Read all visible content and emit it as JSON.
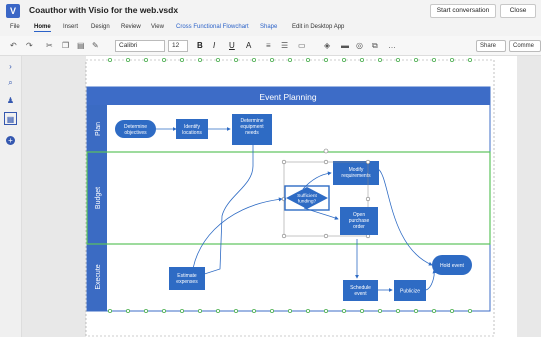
{
  "app": {
    "title": "Coauthor with Visio for the web.vsdx",
    "start_conversation": "Start conversation",
    "close": "Close"
  },
  "tabs": [
    "File",
    "Home",
    "Insert",
    "Design",
    "Review",
    "View",
    "Cross Functional Flowchart",
    "Shape",
    "Edit in Desktop App"
  ],
  "ribbon": {
    "font_name": "Calibri",
    "font_size": "12",
    "share": "Share",
    "comments": "Comme"
  },
  "diagram": {
    "title": "Event Planning",
    "lanes": [
      "Plan",
      "Budget",
      "Execute"
    ],
    "shapes": {
      "determine_objectives": "Determine objectives",
      "identify_locations": "Identify locations",
      "determine_equipment": "Determine equipment needs",
      "modify_requirements": "Modify requirements",
      "sufficient_funding": "Sufficient funding?",
      "open_purchase_order": "Open purchase order",
      "estimate_expenses": "Estimate expenses",
      "schedule_event": "Schedule event",
      "publicize": "Publicize",
      "hold_event": "Hold event"
    }
  },
  "colors": {
    "accent": "#2b62c8",
    "shape_fill": "#2e6bc4",
    "header_fill": "#3d6cc7",
    "lane_header": "#3b6bc3"
  }
}
